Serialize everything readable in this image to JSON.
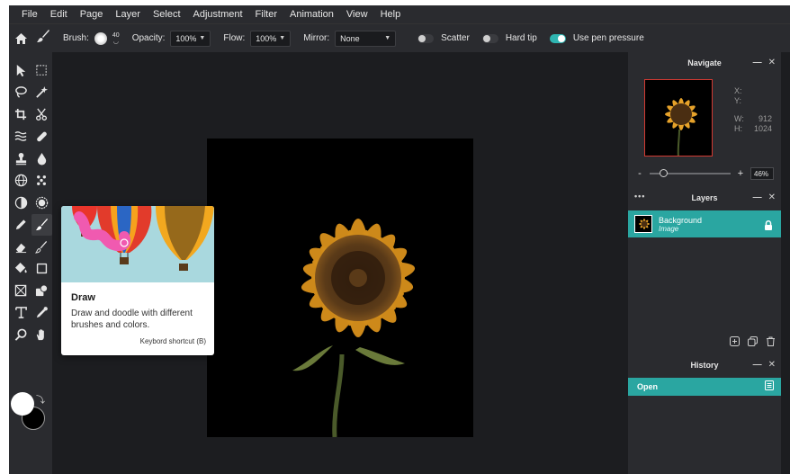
{
  "menu": [
    "File",
    "Edit",
    "Page",
    "Layer",
    "Select",
    "Adjustment",
    "Filter",
    "Animation",
    "View",
    "Help"
  ],
  "options": {
    "brush_label": "Brush:",
    "brush_size": "40",
    "opacity_label": "Opacity:",
    "opacity_value": "100%",
    "flow_label": "Flow:",
    "flow_value": "100%",
    "mirror_label": "Mirror:",
    "mirror_value": "None",
    "scatter_label": "Scatter",
    "scatter_on": false,
    "hard_tip_label": "Hard tip",
    "hard_tip_on": false,
    "pen_pressure_label": "Use pen pressure",
    "pen_pressure_on": true
  },
  "tools": [
    {
      "name": "select-arrow-icon",
      "active": false
    },
    {
      "name": "marquee-icon",
      "active": false
    },
    {
      "name": "lasso-icon",
      "active": false
    },
    {
      "name": "magic-wand-icon",
      "active": false
    },
    {
      "name": "crop-icon",
      "active": false
    },
    {
      "name": "scissors-icon",
      "active": false
    },
    {
      "name": "liquify-icon",
      "active": false
    },
    {
      "name": "healing-bandage-icon",
      "active": false
    },
    {
      "name": "clone-stamp-icon",
      "active": false
    },
    {
      "name": "blur-drop-icon",
      "active": false
    },
    {
      "name": "globe-icon",
      "active": false
    },
    {
      "name": "pattern-dots-icon",
      "active": false
    },
    {
      "name": "dodge-burn-icon",
      "active": false
    },
    {
      "name": "sponge-icon",
      "active": false
    },
    {
      "name": "pencil-icon",
      "active": false
    },
    {
      "name": "brush-icon",
      "active": true
    },
    {
      "name": "eraser-icon",
      "active": false
    },
    {
      "name": "color-replace-icon",
      "active": false
    },
    {
      "name": "paint-bucket-icon",
      "active": false
    },
    {
      "name": "gradient-icon",
      "active": false
    },
    {
      "name": "frame-icon",
      "active": false
    },
    {
      "name": "shape-icon",
      "active": false
    },
    {
      "name": "text-icon",
      "active": false
    },
    {
      "name": "eyedropper-icon",
      "active": false
    },
    {
      "name": "zoom-icon",
      "active": false
    },
    {
      "name": "hand-icon",
      "active": false
    }
  ],
  "colors": {
    "foreground": "#ffffff",
    "background": "#000000",
    "accent": "#2aa6a1"
  },
  "tooltip": {
    "title": "Draw",
    "description": "Draw and doodle with different brushes and colors.",
    "shortcut": "Keybord shortcut (B)"
  },
  "navigate": {
    "title": "Navigate",
    "x_label": "X:",
    "x_value": "",
    "y_label": "Y:",
    "y_value": "",
    "w_label": "W:",
    "w_value": "912",
    "h_label": "H:",
    "h_value": "1024",
    "zoom_minus": "-",
    "zoom_plus": "+",
    "zoom_value": "46%"
  },
  "layers": {
    "title": "Layers",
    "more": "•••",
    "items": [
      {
        "name": "Background",
        "type": "Image",
        "locked": true
      }
    ]
  },
  "history": {
    "title": "History",
    "items": [
      {
        "label": "Open"
      }
    ]
  }
}
